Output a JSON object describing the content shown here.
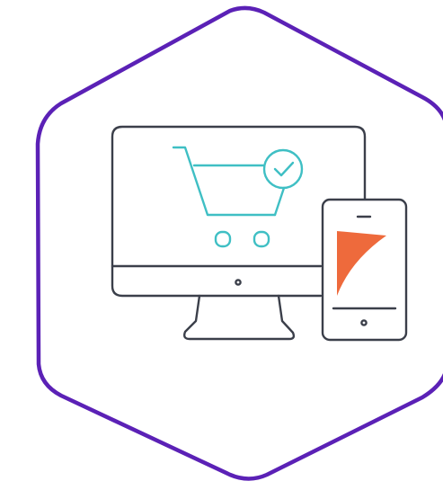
{
  "colors": {
    "hexagon_stroke": "#5b21b6",
    "device_stroke": "#3b3f4a",
    "cart_stroke": "#3fbfc4",
    "logo_fill": "#ee6a3c",
    "background": "#ffffff"
  },
  "icons": {
    "hexagon": "hexagon-frame-icon",
    "monitor": "desktop-monitor-icon",
    "cart": "shopping-cart-icon",
    "check": "check-badge-icon",
    "phone": "smartphone-icon",
    "logo": "brand-logo-icon"
  }
}
